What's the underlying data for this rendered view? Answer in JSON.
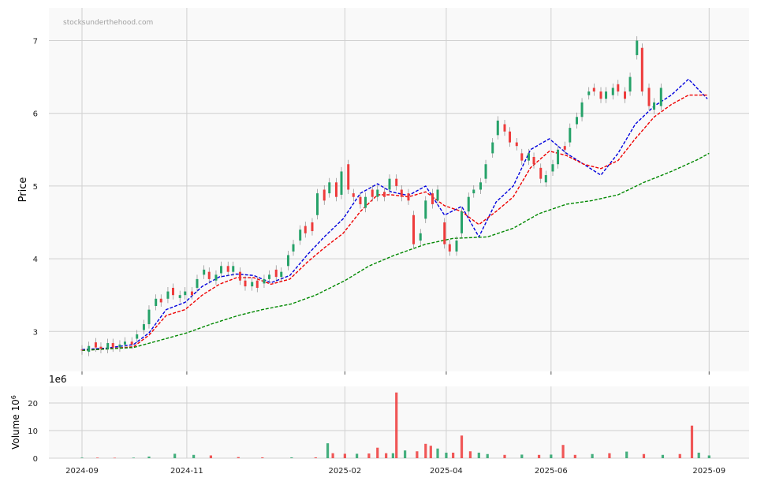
{
  "watermark": "stocksunderthehood.com",
  "chart_data": [
    {
      "type": "candlestick",
      "ylabel": "Price",
      "ylim": [
        2.45,
        7.45
      ],
      "yticks": [
        3,
        4,
        5,
        6,
        7
      ],
      "grid": true,
      "up_color": "#26a269",
      "down_color": "#ee3b3b",
      "moving_averages": [
        {
          "color": "#0000dd",
          "style": "dashed",
          "points": [
            [
              "2024-09-01",
              2.75
            ],
            [
              "2024-09-15",
              2.77
            ],
            [
              "2024-10-01",
              2.82
            ],
            [
              "2024-10-10",
              2.98
            ],
            [
              "2024-10-20",
              3.3
            ],
            [
              "2024-10-31",
              3.4
            ],
            [
              "2024-11-10",
              3.62
            ],
            [
              "2024-11-20",
              3.75
            ],
            [
              "2024-11-30",
              3.79
            ],
            [
              "2024-12-10",
              3.77
            ],
            [
              "2024-12-20",
              3.67
            ],
            [
              "2024-12-31",
              3.77
            ],
            [
              "2025-01-10",
              4.05
            ],
            [
              "2025-01-20",
              4.3
            ],
            [
              "2025-01-31",
              4.55
            ],
            [
              "2025-02-10",
              4.9
            ],
            [
              "2025-02-20",
              5.03
            ],
            [
              "2025-02-28",
              4.92
            ],
            [
              "2025-03-10",
              4.87
            ],
            [
              "2025-03-20",
              5.0
            ],
            [
              "2025-03-31",
              4.6
            ],
            [
              "2025-04-10",
              4.72
            ],
            [
              "2025-04-20",
              4.3
            ],
            [
              "2025-04-30",
              4.78
            ],
            [
              "2025-05-10",
              5.0
            ],
            [
              "2025-05-20",
              5.5
            ],
            [
              "2025-05-31",
              5.65
            ],
            [
              "2025-06-10",
              5.45
            ],
            [
              "2025-06-20",
              5.3
            ],
            [
              "2025-06-30",
              5.15
            ],
            [
              "2025-07-10",
              5.45
            ],
            [
              "2025-07-20",
              5.85
            ],
            [
              "2025-07-31",
              6.1
            ],
            [
              "2025-08-10",
              6.25
            ],
            [
              "2025-08-20",
              6.47
            ],
            [
              "2025-08-31",
              6.2
            ]
          ]
        },
        {
          "color": "#ee0000",
          "style": "dashed",
          "points": [
            [
              "2024-09-01",
              2.74
            ],
            [
              "2024-09-15",
              2.76
            ],
            [
              "2024-10-01",
              2.79
            ],
            [
              "2024-10-10",
              2.95
            ],
            [
              "2024-10-20",
              3.22
            ],
            [
              "2024-10-31",
              3.3
            ],
            [
              "2024-11-10",
              3.5
            ],
            [
              "2024-11-20",
              3.65
            ],
            [
              "2024-11-30",
              3.74
            ],
            [
              "2024-12-10",
              3.74
            ],
            [
              "2024-12-20",
              3.65
            ],
            [
              "2024-12-31",
              3.72
            ],
            [
              "2025-01-10",
              3.95
            ],
            [
              "2025-01-20",
              4.15
            ],
            [
              "2025-01-31",
              4.35
            ],
            [
              "2025-02-10",
              4.65
            ],
            [
              "2025-02-20",
              4.88
            ],
            [
              "2025-02-28",
              4.88
            ],
            [
              "2025-03-10",
              4.85
            ],
            [
              "2025-03-20",
              4.92
            ],
            [
              "2025-03-31",
              4.73
            ],
            [
              "2025-04-10",
              4.65
            ],
            [
              "2025-04-20",
              4.47
            ],
            [
              "2025-04-30",
              4.65
            ],
            [
              "2025-05-10",
              4.85
            ],
            [
              "2025-05-20",
              5.25
            ],
            [
              "2025-05-31",
              5.48
            ],
            [
              "2025-06-10",
              5.42
            ],
            [
              "2025-06-20",
              5.3
            ],
            [
              "2025-06-30",
              5.24
            ],
            [
              "2025-07-10",
              5.35
            ],
            [
              "2025-07-20",
              5.65
            ],
            [
              "2025-07-31",
              5.95
            ],
            [
              "2025-08-10",
              6.12
            ],
            [
              "2025-08-20",
              6.25
            ],
            [
              "2025-08-31",
              6.25
            ]
          ]
        },
        {
          "color": "#008800",
          "style": "dashed",
          "points": [
            [
              "2024-09-01",
              2.74
            ],
            [
              "2024-10-01",
              2.78
            ],
            [
              "2024-10-15",
              2.87
            ],
            [
              "2024-11-01",
              2.98
            ],
            [
              "2024-11-15",
              3.1
            ],
            [
              "2024-12-01",
              3.22
            ],
            [
              "2024-12-15",
              3.3
            ],
            [
              "2025-01-01",
              3.38
            ],
            [
              "2025-01-15",
              3.5
            ],
            [
              "2025-02-01",
              3.7
            ],
            [
              "2025-02-15",
              3.9
            ],
            [
              "2025-03-01",
              4.04
            ],
            [
              "2025-03-20",
              4.2
            ],
            [
              "2025-04-05",
              4.28
            ],
            [
              "2025-04-25",
              4.3
            ],
            [
              "2025-05-10",
              4.42
            ],
            [
              "2025-05-25",
              4.62
            ],
            [
              "2025-06-10",
              4.75
            ],
            [
              "2025-06-25",
              4.8
            ],
            [
              "2025-07-10",
              4.88
            ],
            [
              "2025-07-25",
              5.05
            ],
            [
              "2025-08-10",
              5.2
            ],
            [
              "2025-08-25",
              5.36
            ],
            [
              "2025-09-01",
              5.45
            ]
          ]
        }
      ],
      "candles": [
        [
          "2024-09-01",
          2.75,
          2.74
        ],
        [
          "2024-09-05",
          2.72,
          2.8
        ],
        [
          "2024-09-09",
          2.85,
          2.78
        ],
        [
          "2024-09-12",
          2.79,
          2.76
        ],
        [
          "2024-09-16",
          2.76,
          2.84
        ],
        [
          "2024-09-19",
          2.84,
          2.78
        ],
        [
          "2024-09-23",
          2.78,
          2.82
        ],
        [
          "2024-09-26",
          2.82,
          2.86
        ],
        [
          "2024-09-30",
          2.86,
          2.82
        ],
        [
          "2024-10-03",
          2.9,
          2.96
        ],
        [
          "2024-10-07",
          3.02,
          3.1
        ],
        [
          "2024-10-10",
          3.1,
          3.3
        ],
        [
          "2024-10-14",
          3.35,
          3.45
        ],
        [
          "2024-10-17",
          3.45,
          3.4
        ],
        [
          "2024-10-21",
          3.45,
          3.55
        ],
        [
          "2024-10-24",
          3.6,
          3.5
        ],
        [
          "2024-10-28",
          3.46,
          3.5
        ],
        [
          "2024-10-31",
          3.5,
          3.55
        ],
        [
          "2024-11-04",
          3.55,
          3.5
        ],
        [
          "2024-11-07",
          3.6,
          3.72
        ],
        [
          "2024-11-11",
          3.78,
          3.85
        ],
        [
          "2024-11-14",
          3.82,
          3.72
        ],
        [
          "2024-11-18",
          3.7,
          3.78
        ],
        [
          "2024-11-21",
          3.8,
          3.9
        ],
        [
          "2024-11-25",
          3.9,
          3.82
        ],
        [
          "2024-11-28",
          3.82,
          3.9
        ],
        [
          "2024-12-02",
          3.82,
          3.7
        ],
        [
          "2024-12-05",
          3.7,
          3.62
        ],
        [
          "2024-12-09",
          3.62,
          3.68
        ],
        [
          "2024-12-12",
          3.7,
          3.6
        ],
        [
          "2024-12-16",
          3.66,
          3.72
        ],
        [
          "2024-12-19",
          3.72,
          3.78
        ],
        [
          "2024-12-23",
          3.85,
          3.75
        ],
        [
          "2024-12-26",
          3.75,
          3.82
        ],
        [
          "2024-12-30",
          3.9,
          4.05
        ],
        [
          "2025-01-02",
          4.1,
          4.2
        ],
        [
          "2025-01-06",
          4.25,
          4.4
        ],
        [
          "2025-01-09",
          4.45,
          4.35
        ],
        [
          "2025-01-13",
          4.5,
          4.38
        ],
        [
          "2025-01-16",
          4.6,
          4.9
        ],
        [
          "2025-01-20",
          4.95,
          4.8
        ],
        [
          "2025-01-23",
          4.9,
          5.05
        ],
        [
          "2025-01-27",
          5.05,
          4.85
        ],
        [
          "2025-01-30",
          4.88,
          5.2
        ],
        [
          "2025-02-03",
          5.3,
          4.95
        ],
        [
          "2025-02-06",
          4.9,
          4.85
        ],
        [
          "2025-02-10",
          4.85,
          4.75
        ],
        [
          "2025-02-13",
          4.7,
          4.85
        ],
        [
          "2025-02-17",
          4.95,
          4.85
        ],
        [
          "2025-02-20",
          4.85,
          4.95
        ],
        [
          "2025-02-24",
          4.92,
          4.85
        ],
        [
          "2025-02-27",
          4.95,
          5.1
        ],
        [
          "2025-03-03",
          5.1,
          5.0
        ],
        [
          "2025-03-06",
          4.95,
          4.85
        ],
        [
          "2025-03-10",
          4.9,
          4.8
        ],
        [
          "2025-03-13",
          4.6,
          4.2
        ],
        [
          "2025-03-17",
          4.25,
          4.35
        ],
        [
          "2025-03-20",
          4.55,
          4.8
        ],
        [
          "2025-03-24",
          4.9,
          4.75
        ],
        [
          "2025-03-27",
          4.8,
          4.95
        ],
        [
          "2025-03-31",
          4.5,
          4.2
        ],
        [
          "2025-04-03",
          4.2,
          4.1
        ],
        [
          "2025-04-07",
          4.1,
          4.25
        ],
        [
          "2025-04-10",
          4.35,
          4.65
        ],
        [
          "2025-04-14",
          4.65,
          4.85
        ],
        [
          "2025-04-17",
          4.9,
          4.95
        ],
        [
          "2025-04-21",
          4.95,
          5.05
        ],
        [
          "2025-04-24",
          5.1,
          5.3
        ],
        [
          "2025-04-28",
          5.45,
          5.6
        ],
        [
          "2025-05-01",
          5.7,
          5.9
        ],
        [
          "2025-05-05",
          5.85,
          5.75
        ],
        [
          "2025-05-08",
          5.75,
          5.6
        ],
        [
          "2025-05-12",
          5.6,
          5.55
        ],
        [
          "2025-05-15",
          5.45,
          5.35
        ],
        [
          "2025-05-19",
          5.35,
          5.45
        ],
        [
          "2025-05-22",
          5.4,
          5.3
        ],
        [
          "2025-05-26",
          5.25,
          5.1
        ],
        [
          "2025-05-29",
          5.05,
          5.15
        ],
        [
          "2025-06-02",
          5.2,
          5.3
        ],
        [
          "2025-06-05",
          5.3,
          5.5
        ],
        [
          "2025-06-09",
          5.55,
          5.5
        ],
        [
          "2025-06-12",
          5.6,
          5.8
        ],
        [
          "2025-06-16",
          5.85,
          5.95
        ],
        [
          "2025-06-19",
          5.95,
          6.15
        ],
        [
          "2025-06-23",
          6.25,
          6.3
        ],
        [
          "2025-06-26",
          6.35,
          6.3
        ],
        [
          "2025-06-30",
          6.3,
          6.2
        ],
        [
          "2025-07-03",
          6.2,
          6.3
        ],
        [
          "2025-07-07",
          6.25,
          6.35
        ],
        [
          "2025-07-10",
          6.4,
          6.3
        ],
        [
          "2025-07-14",
          6.3,
          6.2
        ],
        [
          "2025-07-17",
          6.3,
          6.5
        ],
        [
          "2025-07-21",
          6.8,
          7.0
        ],
        [
          "2025-07-24",
          6.9,
          6.3
        ],
        [
          "2025-07-28",
          6.35,
          6.1
        ],
        [
          "2025-07-31",
          6.05,
          6.15
        ],
        [
          "2025-08-04",
          6.1,
          6.35
        ]
      ],
      "x_range": [
        "2024-09-01",
        "2025-09-05"
      ]
    },
    {
      "type": "bar",
      "ylabel": "Volume",
      "ylabel_exponent": "6",
      "offset_label": "1e6",
      "ylim": [
        0,
        26
      ],
      "yticks": [
        0,
        10,
        20
      ],
      "xticks": [
        "2024-09",
        "2024-11",
        "2025-02",
        "2025-04",
        "2025-06",
        "2025-09"
      ],
      "grid": true,
      "bars": [
        [
          "2024-09-01",
          0.2,
          "up"
        ],
        [
          "2024-09-10",
          0.2,
          "down"
        ],
        [
          "2024-09-20",
          0.15,
          "down"
        ],
        [
          "2024-10-01",
          0.2,
          "up"
        ],
        [
          "2024-10-10",
          0.6,
          "up"
        ],
        [
          "2024-10-25",
          1.6,
          "up"
        ],
        [
          "2024-11-05",
          1.2,
          "up"
        ],
        [
          "2024-11-15",
          1.0,
          "down"
        ],
        [
          "2024-12-01",
          0.4,
          "down"
        ],
        [
          "2024-12-15",
          0.3,
          "down"
        ],
        [
          "2025-01-01",
          0.3,
          "up"
        ],
        [
          "2025-01-15",
          0.3,
          "down"
        ],
        [
          "2025-01-22",
          5.4,
          "up"
        ],
        [
          "2025-01-25",
          1.8,
          "down"
        ],
        [
          "2025-02-01",
          1.6,
          "down"
        ],
        [
          "2025-02-08",
          1.6,
          "up"
        ],
        [
          "2025-02-15",
          1.7,
          "down"
        ],
        [
          "2025-02-20",
          3.8,
          "down"
        ],
        [
          "2025-02-25",
          1.8,
          "down"
        ],
        [
          "2025-03-01",
          1.8,
          "up"
        ],
        [
          "2025-03-03",
          23.8,
          "down"
        ],
        [
          "2025-03-08",
          2.8,
          "up"
        ],
        [
          "2025-03-15",
          2.5,
          "down"
        ],
        [
          "2025-03-20",
          5.2,
          "down"
        ],
        [
          "2025-03-23",
          4.5,
          "down"
        ],
        [
          "2025-03-27",
          3.5,
          "up"
        ],
        [
          "2025-04-01",
          2.0,
          "up"
        ],
        [
          "2025-04-05",
          2.0,
          "down"
        ],
        [
          "2025-04-10",
          8.2,
          "down"
        ],
        [
          "2025-04-15",
          2.5,
          "down"
        ],
        [
          "2025-04-20",
          2.0,
          "up"
        ],
        [
          "2025-04-25",
          1.5,
          "up"
        ],
        [
          "2025-05-05",
          1.2,
          "down"
        ],
        [
          "2025-05-15",
          1.3,
          "up"
        ],
        [
          "2025-05-25",
          1.2,
          "down"
        ],
        [
          "2025-06-01",
          1.3,
          "up"
        ],
        [
          "2025-06-08",
          4.8,
          "down"
        ],
        [
          "2025-06-15",
          1.2,
          "down"
        ],
        [
          "2025-06-25",
          1.5,
          "up"
        ],
        [
          "2025-07-05",
          1.8,
          "down"
        ],
        [
          "2025-07-15",
          2.4,
          "up"
        ],
        [
          "2025-07-25",
          1.5,
          "down"
        ],
        [
          "2025-08-05",
          1.2,
          "up"
        ],
        [
          "2025-08-15",
          1.5,
          "down"
        ],
        [
          "2025-08-22",
          11.8,
          "down"
        ],
        [
          "2025-08-26",
          2.0,
          "up"
        ],
        [
          "2025-09-01",
          1.0,
          "up"
        ]
      ]
    }
  ]
}
